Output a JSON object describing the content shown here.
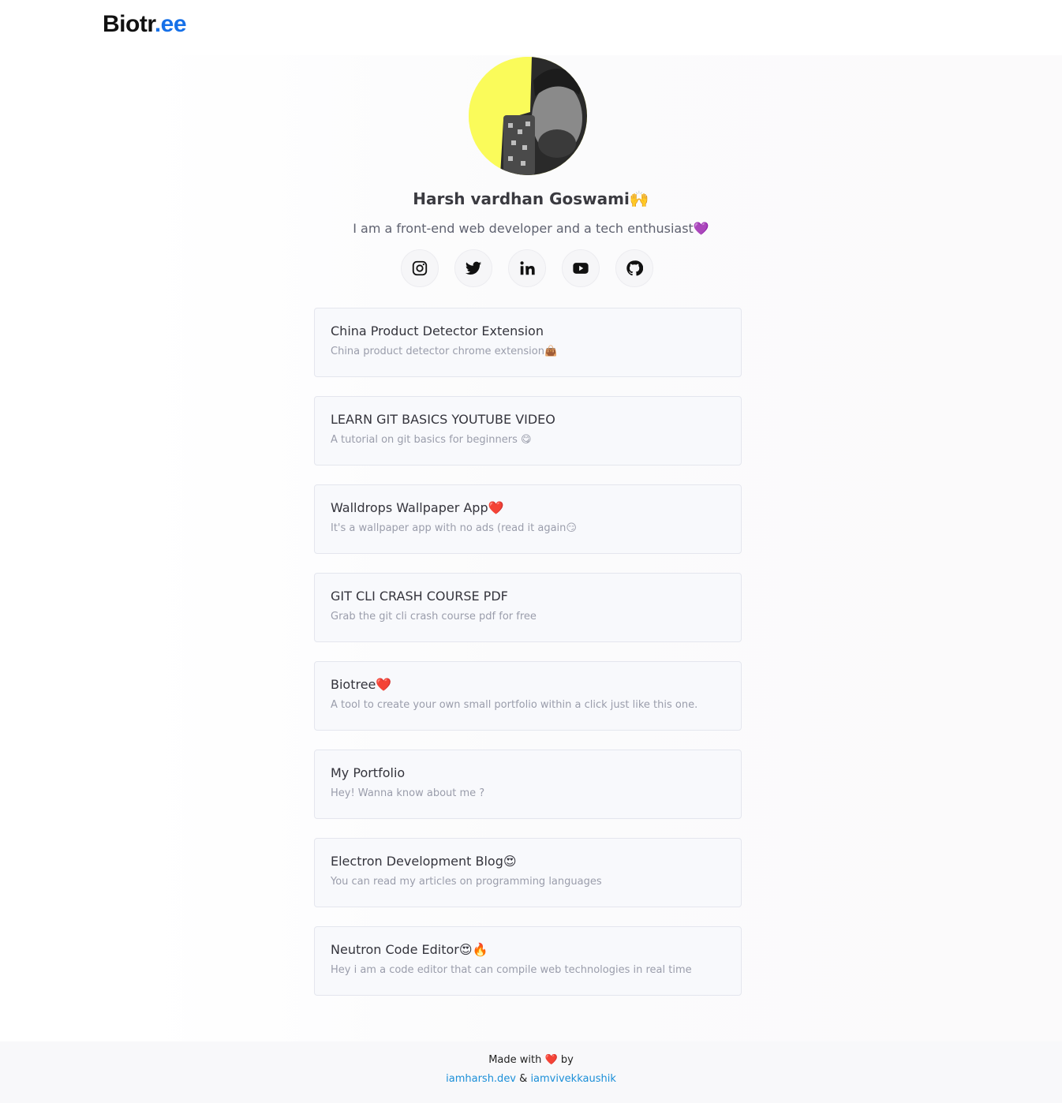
{
  "brand": {
    "name_main": "Biotr",
    "name_accent": ".ee"
  },
  "profile": {
    "name": "Harsh vardhan Goswami🙌",
    "bio": "I am a front-end web developer and a tech enthusiast💜"
  },
  "socials": [
    {
      "icon": "instagram-icon"
    },
    {
      "icon": "twitter-icon"
    },
    {
      "icon": "linkedin-icon"
    },
    {
      "icon": "youtube-icon"
    },
    {
      "icon": "github-icon"
    }
  ],
  "links": [
    {
      "title": "China Product Detector Extension",
      "desc": "China product detector chrome extension👜"
    },
    {
      "title": "LEARN GIT BASICS YOUTUBE VIDEO",
      "desc": "A tutorial on git basics for beginners 😋"
    },
    {
      "title": "Walldrops Wallpaper App❤️",
      "desc": "It's a wallpaper app with no ads (read it again😏"
    },
    {
      "title": "GIT CLI CRASH COURSE PDF",
      "desc": "Grab the git cli crash course pdf for free"
    },
    {
      "title": "Biotree❤️",
      "desc": "A tool to create your own small portfolio within a click just like this one."
    },
    {
      "title": "My Portfolio",
      "desc": "Hey! Wanna know about me ?"
    },
    {
      "title": "Electron Development Blog😍",
      "desc": "You can read my articles on programming languages"
    },
    {
      "title": "Neutron Code Editor😍🔥",
      "desc": "Hey i am a code editor that can compile web technologies in real time"
    }
  ],
  "footer": {
    "made_prefix": "Made with",
    "heart": "❤️",
    "made_suffix": "by",
    "author1": "iamharsh.dev",
    "separator": "&",
    "author2": "iamvivekkaushik"
  },
  "colors": {
    "accent": "#1670e8",
    "link": "#1b8fd8",
    "avatar_bg": "#fafb5a"
  }
}
